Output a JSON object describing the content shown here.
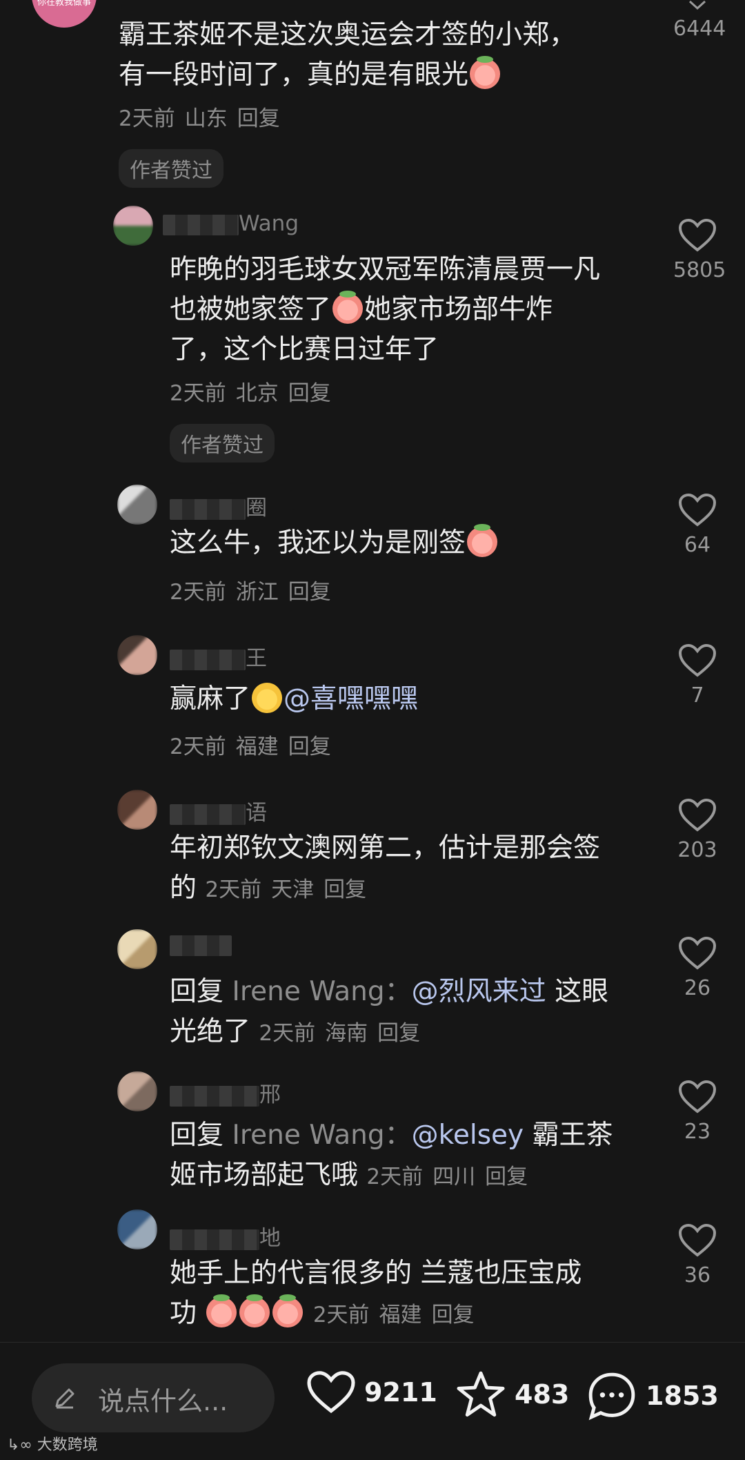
{
  "comments": [
    {
      "text_line1": "霸王茶姬不是这次奥运会才签的小郑，",
      "text_line2": "有一段时间了，真的是有眼光",
      "time": "2天前",
      "location": "山东",
      "reply": "回复",
      "badge": "作者赞过",
      "likes": "6444"
    },
    {
      "name_suffix": "Wang",
      "line1": "昨晚的羽毛球女双冠军陈清晨贾一凡",
      "line2a": "也被她家签了",
      "line2b": "她家市场部牛炸",
      "line3": "了，这个比赛日过年了",
      "time": "2天前",
      "location": "北京",
      "reply": "回复",
      "badge": "作者赞过",
      "likes": "5805"
    },
    {
      "name_suffix": "圈",
      "text": "这么牛，我还以为是刚签",
      "time": "2天前",
      "location": "浙江",
      "reply": "回复",
      "likes": "64"
    },
    {
      "name_suffix": "王",
      "text": "赢麻了",
      "mention": "@喜嘿嘿嘿",
      "time": "2天前",
      "location": "福建",
      "reply": "回复",
      "likes": "7"
    },
    {
      "name_suffix": "语",
      "line1": "年初郑钦文澳网第二，估计是那会签",
      "line2": "的",
      "time": "2天前",
      "location": "天津",
      "reply": "回复",
      "likes": "203"
    },
    {
      "reply_prefix": "回复",
      "reply_to": "Irene Wang",
      "colon": "：",
      "mention": "@烈风来过",
      "text_after": "这眼",
      "line2": "光绝了",
      "time": "2天前",
      "location": "海南",
      "reply": "回复",
      "likes": "26"
    },
    {
      "name_suffix": "邢",
      "reply_prefix": "回复",
      "reply_to": "Irene Wang",
      "colon": "：",
      "mention": "@kelsey",
      "text_after": "霸王茶",
      "line2": "姬市场部起飞哦",
      "time": "2天前",
      "location": "四川",
      "reply": "回复",
      "likes": "23"
    },
    {
      "name_suffix": "地",
      "line1": "她手上的代言很多的 兰蔻也压宝成",
      "line2": "功",
      "time": "2天前",
      "location": "福建",
      "reply": "回复",
      "likes": "36"
    }
  ],
  "bottom": {
    "placeholder": "说点什么...",
    "likes": "9211",
    "favorites": "483",
    "comments": "1853"
  },
  "watermark": "大数跨境",
  "avatar_top_text": "你在教我做事"
}
